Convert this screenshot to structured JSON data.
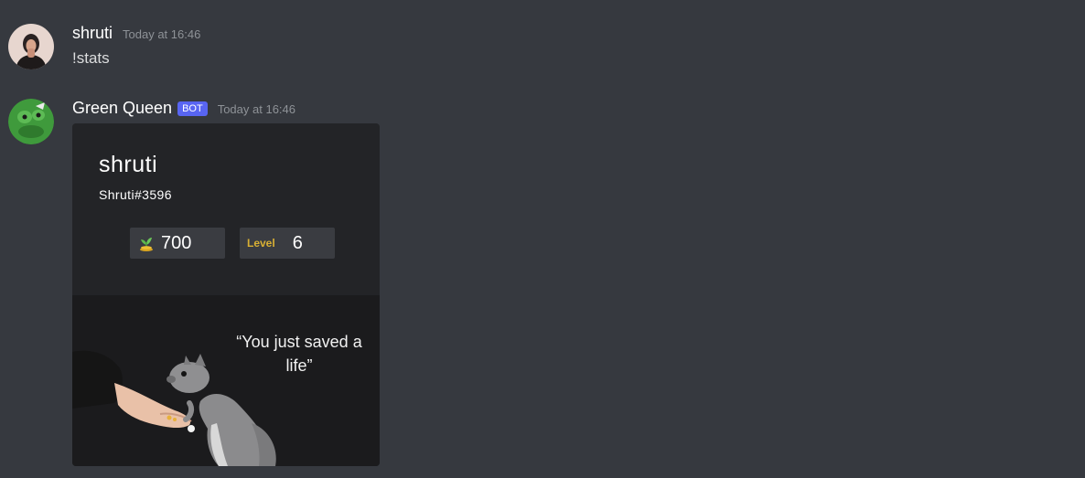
{
  "messages": [
    {
      "username": "shruti",
      "timestamp": "Today at 16:46",
      "text": "!stats"
    },
    {
      "username": "Green Queen",
      "bot_tag": "BOT",
      "timestamp": "Today at 16:46"
    }
  ],
  "card": {
    "name": "shruti",
    "tag": "Shruti#3596",
    "points_icon": "sprout-coins-icon",
    "points": "700",
    "level_label": "Level",
    "level": "6",
    "quote": "“You just saved a life”",
    "accent_color": "#d8b034"
  },
  "colors": {
    "background": "#36393f",
    "card_background": "#232427",
    "bot_tag": "#5865f2"
  }
}
